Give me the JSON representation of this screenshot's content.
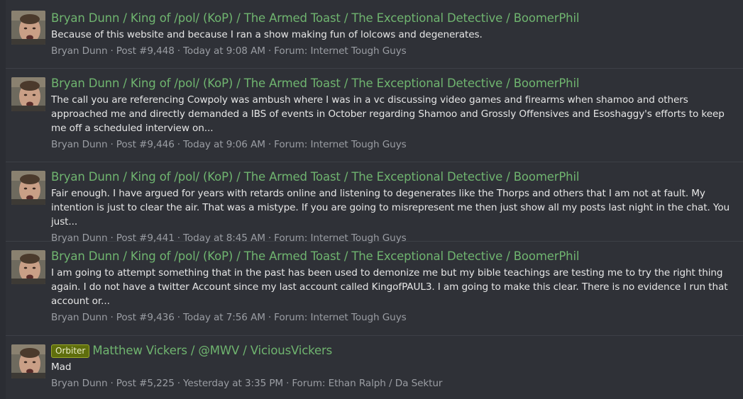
{
  "results": [
    {
      "badge": "",
      "title": "Bryan Dunn / King of /pol/ (KoP) / The Armed Toast / The Exceptional Detective / BoomerPhil",
      "snippet": "Because of this website and because I ran a show making fun of lolcows and degenerates.",
      "author": "Bryan Dunn",
      "post": "Post #9,448",
      "time": "Today at 9:08 AM",
      "forum_label": "Forum:",
      "forum": "Internet Tough Guys"
    },
    {
      "badge": "",
      "title": "Bryan Dunn / King of /pol/ (KoP) / The Armed Toast / The Exceptional Detective / BoomerPhil",
      "snippet": "The call you are referencing Cowpoly was ambush where I was in a vc discussing video games and firearms when shamoo and others approached me and directly demanded a IBS of events in October regarding Shamoo and Grossly Offensives and Esoshaggy's efforts to keep me off a scheduled interview on...",
      "author": "Bryan Dunn",
      "post": "Post #9,446",
      "time": "Today at 9:06 AM",
      "forum_label": "Forum:",
      "forum": "Internet Tough Guys"
    },
    {
      "badge": "",
      "title": "Bryan Dunn / King of /pol/ (KoP) / The Armed Toast / The Exceptional Detective / BoomerPhil",
      "snippet": "Fair enough. I have argued for years with retards online and listening to degenerates like the Thorps and others that I am not at fault. My intention is just to clear the air. That was a mistype. If you are going to misrepresent me then just show all my posts last night in the chat. You just...",
      "author": "Bryan Dunn",
      "post": "Post #9,441",
      "time": "Today at 8:45 AM",
      "forum_label": "Forum:",
      "forum": "Internet Tough Guys"
    },
    {
      "badge": "",
      "title": "Bryan Dunn / King of /pol/ (KoP) / The Armed Toast / The Exceptional Detective / BoomerPhil",
      "snippet": "I am going to attempt something that in the past has been used to demonize me but my bible teachings are testing me to try the right thing again. I do not have a twitter Account since my last account called KingofPAUL3. I am going to make this clear. There is no evidence I run that account or...",
      "author": "Bryan Dunn",
      "post": "Post #9,436",
      "time": "Today at 7:56 AM",
      "forum_label": "Forum:",
      "forum": "Internet Tough Guys"
    },
    {
      "badge": "Orbiter",
      "title": "Matthew Vickers / @MWV / ViciousVickers",
      "snippet": "Mad",
      "author": "Bryan Dunn",
      "post": "Post #5,225",
      "time": "Yesterday at 3:35 PM",
      "forum_label": "Forum:",
      "forum": "Ethan Ralph / Da Sektur"
    }
  ],
  "separator": "·",
  "avatar_icon": "user-avatar-photo",
  "colors": {
    "title_link": "#6fb46f",
    "badge_bg": "#5f6e0d",
    "snippet_text": "#e6e6e6",
    "meta_text": "#9a9da3",
    "background": "#2f3137"
  }
}
